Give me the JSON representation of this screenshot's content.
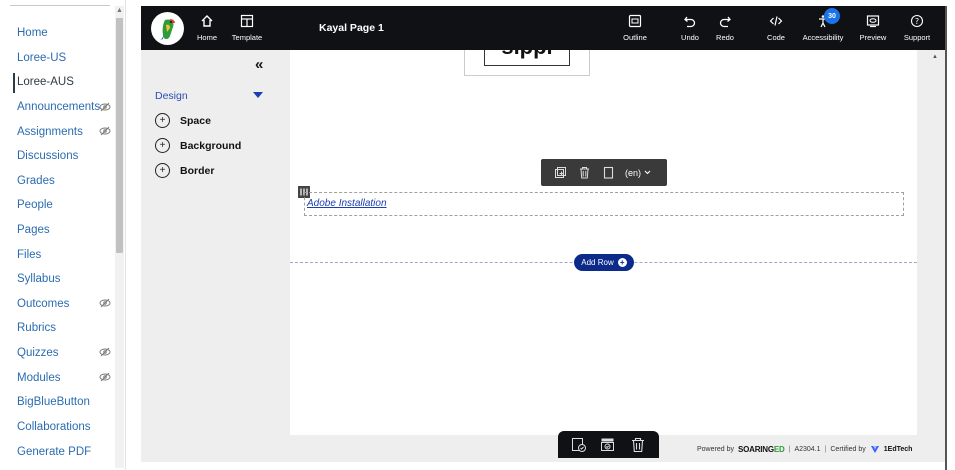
{
  "course_nav": {
    "items": [
      {
        "label": "Home",
        "hidden": false
      },
      {
        "label": "Loree-US",
        "hidden": false
      },
      {
        "label": "Loree-AUS",
        "hidden": false,
        "active": true
      },
      {
        "label": "Announcements",
        "hidden": true
      },
      {
        "label": "Assignments",
        "hidden": true
      },
      {
        "label": "Discussions",
        "hidden": false
      },
      {
        "label": "Grades",
        "hidden": false
      },
      {
        "label": "People",
        "hidden": false
      },
      {
        "label": "Pages",
        "hidden": false
      },
      {
        "label": "Files",
        "hidden": false
      },
      {
        "label": "Syllabus",
        "hidden": false
      },
      {
        "label": "Outcomes",
        "hidden": true
      },
      {
        "label": "Rubrics",
        "hidden": false
      },
      {
        "label": "Quizzes",
        "hidden": true
      },
      {
        "label": "Modules",
        "hidden": true
      },
      {
        "label": "BigBlueButton",
        "hidden": false
      },
      {
        "label": "Collaborations",
        "hidden": false
      },
      {
        "label": "Generate PDF",
        "hidden": false
      }
    ]
  },
  "toolbar": {
    "home_label": "Home",
    "template_label": "Template",
    "page_title": "Kayal Page 1",
    "outline_label": "Outline",
    "undo_label": "Undo",
    "redo_label": "Redo",
    "code_label": "Code",
    "accessibility_label": "Accessibility",
    "accessibility_count": "30",
    "preview_label": "Preview",
    "support_label": "Support"
  },
  "side_panel": {
    "collapse_glyph": "«",
    "design_label": "Design",
    "items": [
      "Space",
      "Background",
      "Border"
    ]
  },
  "canvas": {
    "image_text": "sippi",
    "lang_label": "(en)",
    "link_text": "Adobe Installation",
    "add_row_label": "Add Row"
  },
  "footer": {
    "powered_by": "Powered by",
    "brand_main": "SOARING",
    "brand_ed": "ED",
    "version": "A2304.1",
    "certified_by": "Certified by",
    "certifier": "1EdTech"
  },
  "colors": {
    "toolbar_bg": "#0f1115",
    "link": "#2b6cb0",
    "accent_blue": "#0b2a8a",
    "badge": "#1a73e8"
  }
}
